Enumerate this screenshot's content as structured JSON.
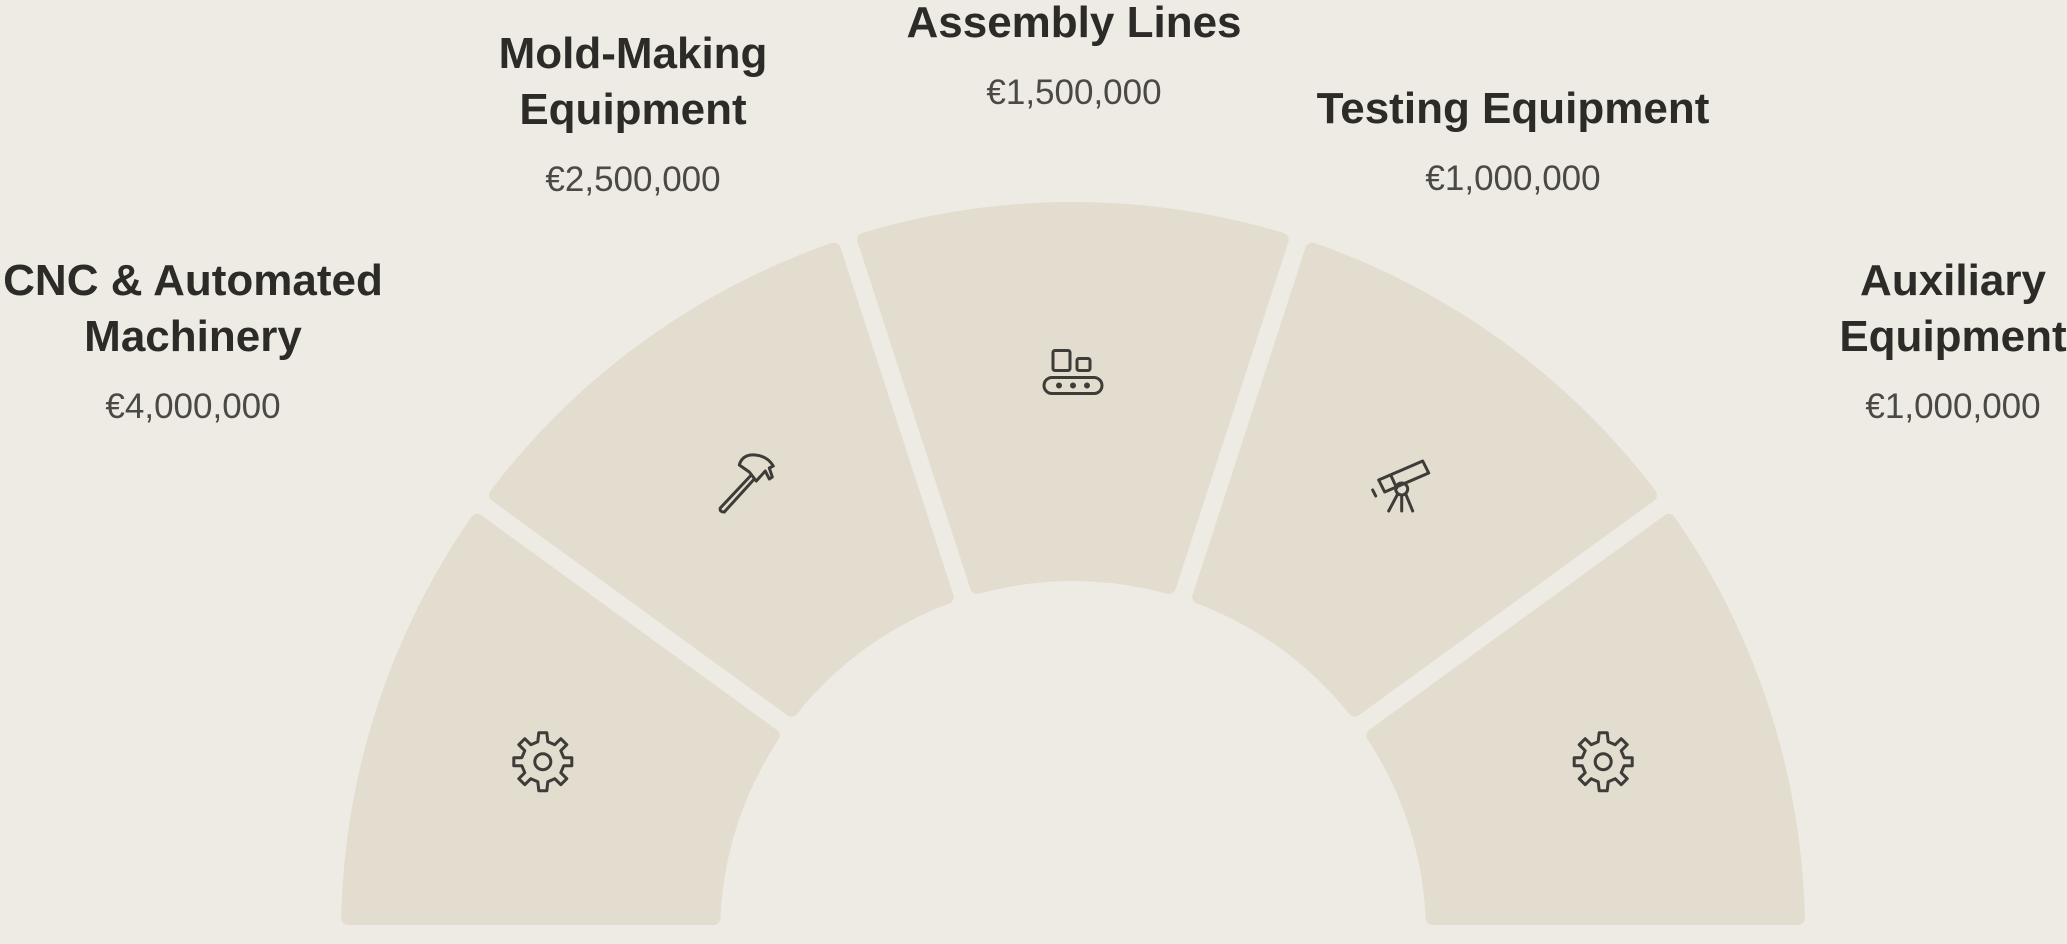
{
  "items": [
    {
      "title_lines": [
        "CNC & Automated",
        "Machinery"
      ],
      "value": "€4,000,000",
      "icon": "gear-icon"
    },
    {
      "title_lines": [
        "Mold-Making",
        "Equipment"
      ],
      "value": "€2,500,000",
      "icon": "hammer-icon"
    },
    {
      "title_lines": [
        "Assembly Lines"
      ],
      "value": "€1,500,000",
      "icon": "conveyor-icon"
    },
    {
      "title_lines": [
        "Testing Equipment"
      ],
      "value": "€1,000,000",
      "icon": "telescope-icon"
    },
    {
      "title_lines": [
        "Auxiliary",
        "Equipment"
      ],
      "value": "€1,000,000",
      "icon": "gear-icon"
    }
  ]
}
